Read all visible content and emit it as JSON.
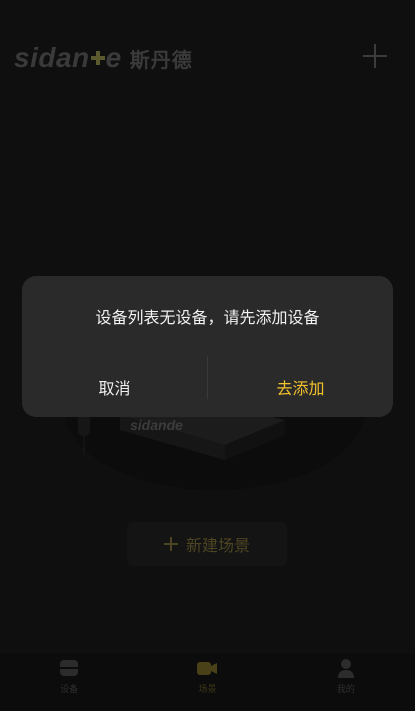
{
  "header": {
    "brand_latin_start": "sidan",
    "brand_latin_end": "e",
    "brand_chinese": "斯丹德"
  },
  "main": {
    "illustration_brand": "sidande",
    "new_scene_label": "新建场景"
  },
  "tabs": [
    {
      "label": "设备"
    },
    {
      "label": "场景"
    },
    {
      "label": "我的"
    }
  ],
  "dialog": {
    "message": "设备列表无设备，请先添加设备",
    "cancel_label": "取消",
    "confirm_label": "去添加"
  },
  "colors": {
    "accent": "#f2c12e",
    "dialog_bg": "#2a2a2a",
    "background": "#0f0f0f"
  }
}
